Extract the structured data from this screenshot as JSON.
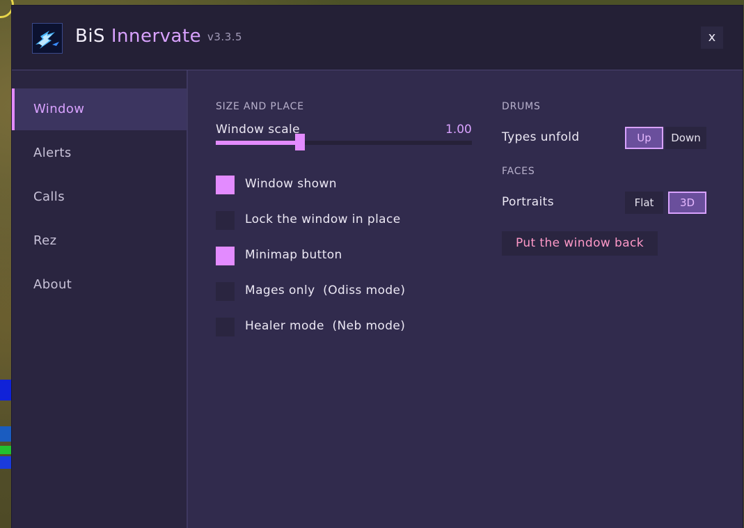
{
  "window": {
    "title_part1": "BiS",
    "title_part2": "Innervate",
    "version": "v3.3.5",
    "close_label": "x",
    "accent_color": "#e38bff"
  },
  "sidebar": {
    "items": [
      {
        "label": "Window",
        "active": true
      },
      {
        "label": "Alerts",
        "active": false
      },
      {
        "label": "Calls",
        "active": false
      },
      {
        "label": "Rez",
        "active": false
      },
      {
        "label": "About",
        "active": false
      }
    ]
  },
  "size_and_place": {
    "section_title": "SIZE AND PLACE",
    "scale_label": "Window scale",
    "scale_value": "1.00",
    "scale_fraction": 0.33
  },
  "options": [
    {
      "label": "Window shown",
      "checked": true
    },
    {
      "label": "Lock the window in place",
      "checked": false
    },
    {
      "label": "Minimap button",
      "checked": true
    },
    {
      "label": "Mages only  (Odiss mode)",
      "checked": false
    },
    {
      "label": "Healer mode  (Neb mode)",
      "checked": false
    }
  ],
  "drums": {
    "section_title": "DRUMS",
    "types_label": "Types unfold",
    "up_label": "Up",
    "down_label": "Down",
    "selected": "Up"
  },
  "faces": {
    "section_title": "FACES",
    "portraits_label": "Portraits",
    "flat_label": "Flat",
    "threed_label": "3D",
    "selected": "3D"
  },
  "reset_button": "Put the window back"
}
